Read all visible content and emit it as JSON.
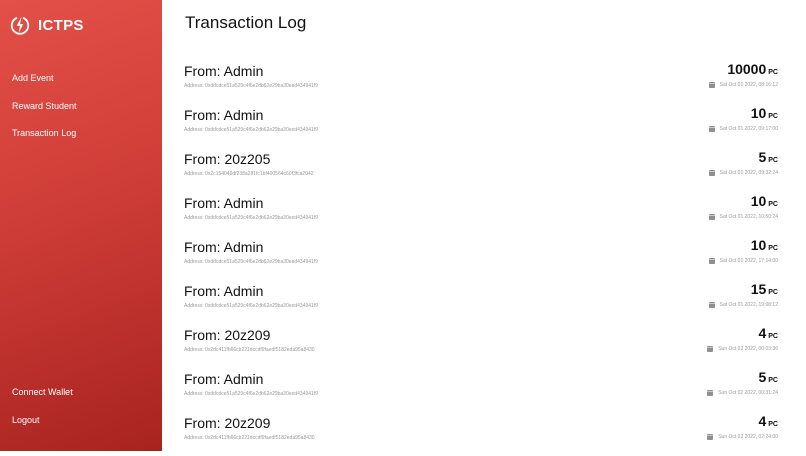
{
  "app": {
    "name": "ICTPS"
  },
  "sidebar": {
    "items": [
      {
        "label": "Add Event"
      },
      {
        "label": "Reward Student"
      },
      {
        "label": "Transaction Log"
      }
    ],
    "bottom_items": [
      {
        "label": "Connect Wallet"
      },
      {
        "label": "Logout"
      }
    ]
  },
  "main": {
    "title": "Transaction Log",
    "transactions": [
      {
        "from": "From: Admin",
        "address": "Address: 0xddcdce51a529c4f6e2db62e29ba30eed434941f9",
        "amount": "10000",
        "unit": "PC",
        "date": "Sat Oct 01 2022, 08:16:12"
      },
      {
        "from": "From: Admin",
        "address": "Address: 0xddcdce51a529c4f6e2db62e29ba30eed434941f9",
        "amount": "10",
        "unit": "PC",
        "date": "Sat Oct 01 2022, 09:17:00"
      },
      {
        "from": "From: 20z205",
        "address": "Address: 0x2c154049df238a281fc1bf400564c60f3fca2042",
        "amount": "5",
        "unit": "PC",
        "date": "Sat Oct 01 2022, 09:32:24"
      },
      {
        "from": "From: Admin",
        "address": "Address: 0xddcdce51a529c4f6e2db62e29ba30eed434941f9",
        "amount": "10",
        "unit": "PC",
        "date": "Sat Oct 01 2022, 10:50:24"
      },
      {
        "from": "From: Admin",
        "address": "Address: 0xddcdce51a529c4f6e2db62e29ba30eed434941f9",
        "amount": "10",
        "unit": "PC",
        "date": "Sat Oct 01 2022, 17:14:00"
      },
      {
        "from": "From: Admin",
        "address": "Address: 0xddcdce51a529c4f6e2db62e29ba30eed434941f9",
        "amount": "15",
        "unit": "PC",
        "date": "Sat Oct 01 2022, 19:08:12"
      },
      {
        "from": "From: 20z209",
        "address": "Address: 0x2dc411fb66cb221dccdf9faedf5182eda95a8430",
        "amount": "4",
        "unit": "PC",
        "date": "Sun Oct 02 2022, 00:03:36"
      },
      {
        "from": "From: Admin",
        "address": "Address: 0xddcdce51a529c4f6e2db62e29ba30eed434941f9",
        "amount": "5",
        "unit": "PC",
        "date": "Sun Oct 02 2022, 00:31:24"
      },
      {
        "from": "From: 20z209",
        "address": "Address: 0x2dc411fb66cb221dccdf9faedf5182eda95a8430",
        "amount": "4",
        "unit": "PC",
        "date": "Sun Oct 02 2022, 02:24:00"
      }
    ]
  },
  "icons": {
    "brand": "power-bolt-logo-icon",
    "date": "calendar-icon"
  },
  "colors": {
    "sidebar_gradient_start": "#e35048",
    "sidebar_gradient_end": "#a8231f",
    "muted_text": "#9a9a9a"
  }
}
